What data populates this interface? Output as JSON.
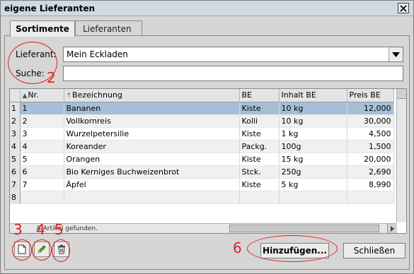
{
  "window": {
    "title": "eigene Lieferanten"
  },
  "tabs": [
    {
      "label": "Sortimente",
      "active": true
    },
    {
      "label": "Lieferanten",
      "active": false
    }
  ],
  "form": {
    "lieferant_label": "Lieferant:",
    "lieferant_value": "Mein Eckladen",
    "suche_label": "Suche:",
    "suche_value": ""
  },
  "table": {
    "columns": [
      "Nr.",
      "Bezeichnung",
      "BE",
      "Inhalt BE",
      "Preis BE"
    ],
    "rows": [
      {
        "rownum": "1",
        "nr": "1",
        "bezeichnung": "Bananen",
        "be": "Kiste",
        "inhalt": "10 kg",
        "preis": "12,000"
      },
      {
        "rownum": "2",
        "nr": "2",
        "bezeichnung": "Vollkornreis",
        "be": "Kolli",
        "inhalt": "10 kg",
        "preis": "30,000"
      },
      {
        "rownum": "3",
        "nr": "3",
        "bezeichnung": "Wurzelpetersilie",
        "be": "Kiste",
        "inhalt": "1 kg",
        "preis": "4,500"
      },
      {
        "rownum": "4",
        "nr": "4",
        "bezeichnung": "Koreander",
        "be": "Packg.",
        "inhalt": "100g",
        "preis": "1,500"
      },
      {
        "rownum": "5",
        "nr": "5",
        "bezeichnung": "Orangen",
        "be": "Kiste",
        "inhalt": "15 kg",
        "preis": "20,000"
      },
      {
        "rownum": "6",
        "nr": "6",
        "bezeichnung": "Bio Kerniges Buchweizenbrot",
        "be": "Stck.",
        "inhalt": "250g",
        "preis": "2,690"
      },
      {
        "rownum": "7",
        "nr": "7",
        "bezeichnung": "Äpfel",
        "be": "Kiste",
        "inhalt": "5 kg",
        "preis": "8,990"
      },
      {
        "rownum": "8",
        "nr": "",
        "bezeichnung": "",
        "be": "",
        "inhalt": "",
        "preis": ""
      }
    ],
    "selected_row": 1
  },
  "status": "8 Artikel gefunden.",
  "toolbar": {
    "new_icon": "new-document-icon",
    "edit_icon": "pencil-icon",
    "delete_icon": "trash-icon"
  },
  "buttons": {
    "add_label": "Hinzufügen...",
    "close_label": "Schließen"
  },
  "annotations": [
    "2",
    "3",
    "4",
    "5",
    "6"
  ],
  "colors": {
    "selection": "#a6bfd8",
    "annotation": "#e02020",
    "titlebar": "#cfd9e3"
  }
}
